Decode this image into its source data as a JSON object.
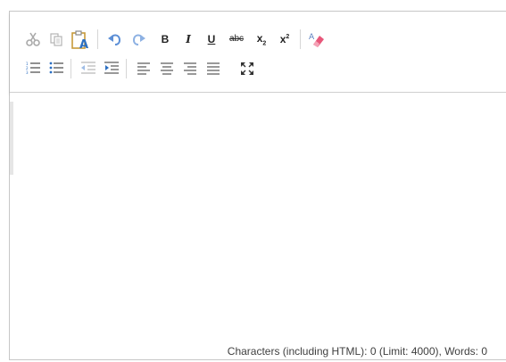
{
  "toolbar": {
    "row1": [
      {
        "name": "cut-button",
        "icon": "cut-icon"
      },
      {
        "name": "copy-button",
        "icon": "copy-icon"
      },
      {
        "name": "paste-text-button",
        "icon": "paste-text-icon"
      },
      {
        "name": "undo-button",
        "icon": "undo-icon"
      },
      {
        "name": "redo-button",
        "icon": "redo-icon"
      },
      {
        "name": "bold-button",
        "icon": "bold-icon"
      },
      {
        "name": "italic-button",
        "icon": "italic-icon"
      },
      {
        "name": "underline-button",
        "icon": "underline-icon"
      },
      {
        "name": "strikethrough-button",
        "icon": "strikethrough-icon"
      },
      {
        "name": "subscript-button",
        "icon": "subscript-icon"
      },
      {
        "name": "superscript-button",
        "icon": "superscript-icon"
      },
      {
        "name": "remove-format-button",
        "icon": "eraser-icon"
      }
    ],
    "row2": [
      {
        "name": "numbered-list-button",
        "icon": "numbered-list-icon"
      },
      {
        "name": "bulleted-list-button",
        "icon": "bulleted-list-icon"
      },
      {
        "name": "outdent-button",
        "icon": "outdent-icon"
      },
      {
        "name": "indent-button",
        "icon": "indent-icon"
      },
      {
        "name": "align-left-button",
        "icon": "align-left-icon"
      },
      {
        "name": "align-center-button",
        "icon": "align-center-icon"
      },
      {
        "name": "align-right-button",
        "icon": "align-right-icon"
      },
      {
        "name": "justify-button",
        "icon": "justify-icon"
      },
      {
        "name": "maximize-button",
        "icon": "maximize-icon"
      }
    ],
    "labels": {
      "bold": "B",
      "italic": "I",
      "underline": "U",
      "strike": "abc",
      "sub_base": "x",
      "sub_script": "2",
      "sup_base": "x",
      "sup_script": "2"
    }
  },
  "status": {
    "counter_text": "Characters (including HTML): 0 (Limit: 4000), Words: 0"
  },
  "colors": {
    "accent_blue": "#2b6fc2",
    "icon_gray": "#9a9a9a",
    "icon_dark": "#333333",
    "eraser_pink": "#e8577a"
  }
}
